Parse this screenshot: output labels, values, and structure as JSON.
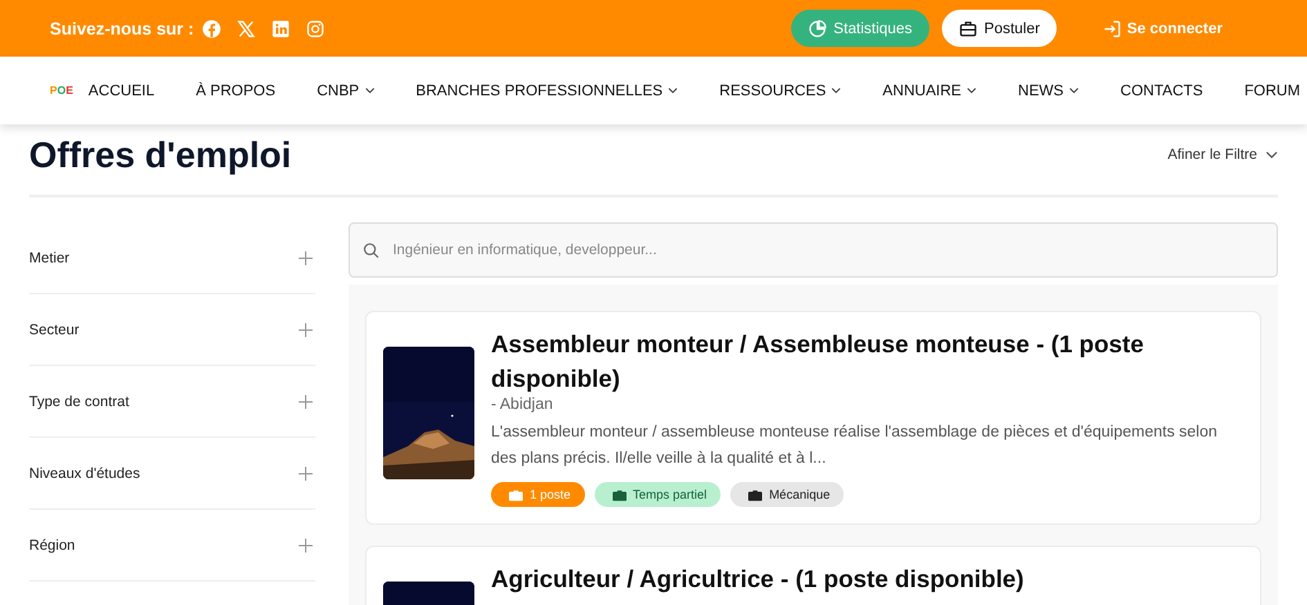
{
  "topbar": {
    "follow_label": "Suivez-nous sur :",
    "socials": [
      {
        "kind": "facebook"
      },
      {
        "kind": "x"
      },
      {
        "kind": "linkedin"
      },
      {
        "kind": "instagram"
      }
    ],
    "stats_button": "Statistiques",
    "apply_button": "Postuler",
    "login_link": "Se connecter"
  },
  "nav": {
    "logo": "POE",
    "items": [
      {
        "label": "ACCUEIL",
        "dropdown": false
      },
      {
        "label": "À PROPOS",
        "dropdown": false
      },
      {
        "label": "CNBP",
        "dropdown": true
      },
      {
        "label": "BRANCHES PROFESSIONNELLES",
        "dropdown": true
      },
      {
        "label": "RESSOURCES",
        "dropdown": true
      },
      {
        "label": "ANNUAIRE",
        "dropdown": true
      },
      {
        "label": "NEWS",
        "dropdown": true
      },
      {
        "label": "CONTACTS",
        "dropdown": false
      },
      {
        "label": "FORUM",
        "dropdown": false
      }
    ]
  },
  "page_title": "Offres d'emploi",
  "filter_toggle": "Afiner le Filtre",
  "filters": [
    {
      "label": "Metier",
      "expanded": false
    },
    {
      "label": "Secteur",
      "expanded": false
    },
    {
      "label": "Type de contrat",
      "expanded": false
    },
    {
      "label": "Niveaux d'études",
      "expanded": false
    },
    {
      "label": "Région",
      "expanded": false
    }
  ],
  "search": {
    "placeholder": "Ingénieur en informatique, developpeur..."
  },
  "jobs": [
    {
      "title": "Assembleur monteur / Assembleuse monteuse - (1 poste disponible)",
      "location": "- Abidjan",
      "description": "L'assembleur monteur / assembleuse monteuse réalise l'assemblage de pièces et d'équipements selon des plans précis. Il/elle veille à la qualité et à l...",
      "tags": [
        {
          "kind": "count",
          "label": "1 poste"
        },
        {
          "kind": "contract",
          "label": "Temps partiel"
        },
        {
          "kind": "sector",
          "label": "Mécanique"
        }
      ]
    },
    {
      "title": "Agriculteur / Agricultrice - (1 poste disponible)"
    }
  ]
}
